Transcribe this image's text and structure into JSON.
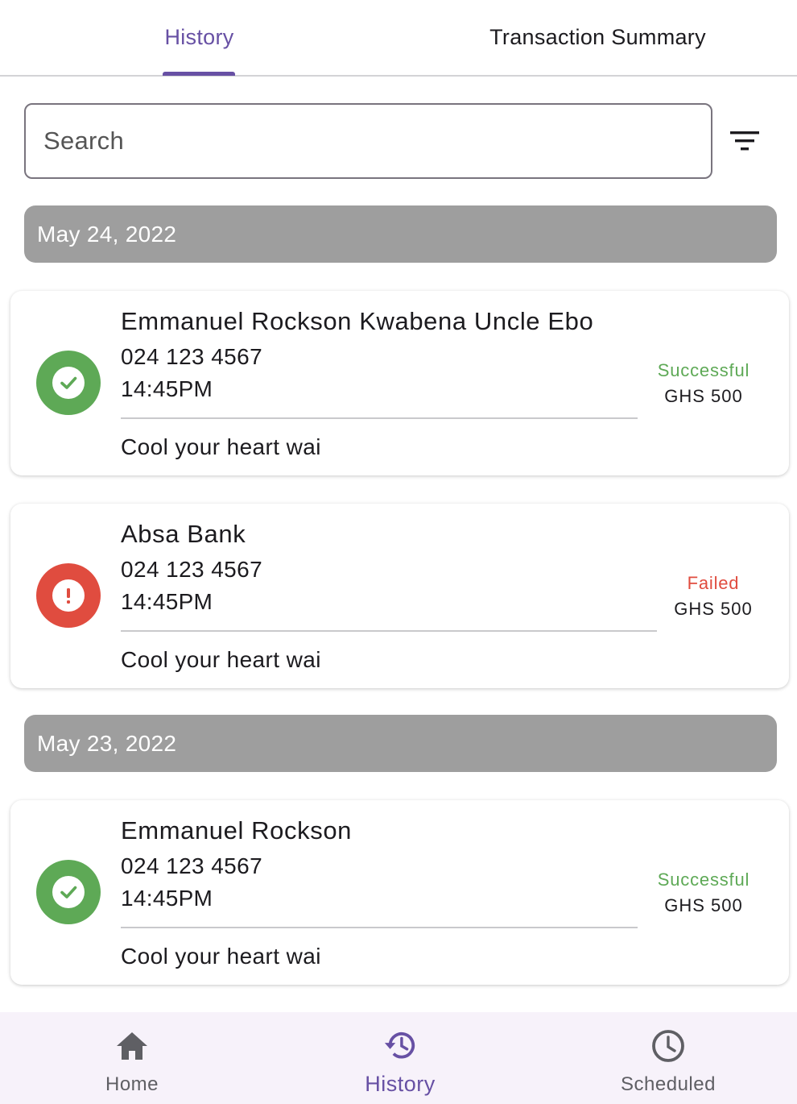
{
  "tabs": {
    "history": "History",
    "summary": "Transaction Summary"
  },
  "search": {
    "placeholder": "Search",
    "value": ""
  },
  "groups": [
    {
      "date": "May 24, 2022",
      "transactions": [
        {
          "name": "Emmanuel Rockson Kwabena Uncle Ebo",
          "phone": "024 123 4567",
          "time": "14:45PM",
          "note": "Cool your heart wai",
          "status": "Successful",
          "amount": "GHS 500",
          "icon": "check-circle-icon"
        },
        {
          "name": "Absa Bank",
          "phone": "024 123 4567",
          "time": "14:45PM",
          "note": "Cool your heart wai",
          "status": "Failed",
          "amount": "GHS 500",
          "icon": "error-circle-icon"
        }
      ]
    },
    {
      "date": "May 23, 2022",
      "transactions": [
        {
          "name": "Emmanuel Rockson",
          "phone": "024 123 4567",
          "time": "14:45PM",
          "note": "Cool your heart wai",
          "status": "Successful",
          "amount": "GHS 500",
          "icon": "check-circle-icon"
        }
      ]
    }
  ],
  "bottom_nav": {
    "items": [
      {
        "label": "Home",
        "icon": "home-icon"
      },
      {
        "label": "History",
        "icon": "history-icon",
        "active": true
      },
      {
        "label": "Scheduled",
        "icon": "clock-icon"
      }
    ]
  },
  "colors": {
    "accent": "#6750a4",
    "success": "#5ea956",
    "failed": "#e04c3f",
    "date_header": "#9e9e9e"
  }
}
